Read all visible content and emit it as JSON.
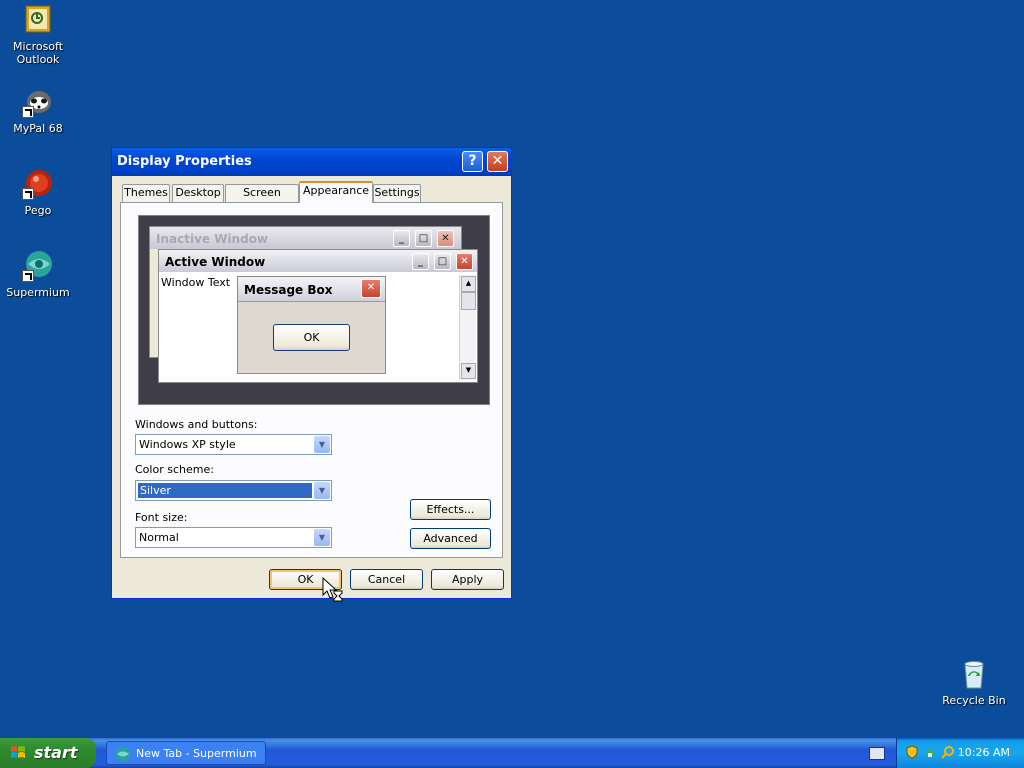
{
  "desktop": {
    "icons": [
      {
        "label_line1": "Microsoft",
        "label_line2": "Outlook"
      },
      {
        "label_line1": "MyPal 68",
        "label_line2": ""
      },
      {
        "label_line1": "Pego",
        "label_line2": ""
      },
      {
        "label_line1": "Supermium",
        "label_line2": ""
      },
      {
        "label_line1": "Recycle Bin",
        "label_line2": ""
      }
    ]
  },
  "dialog": {
    "title": "Display Properties",
    "help_glyph": "?",
    "close_glyph": "✕",
    "tabs": [
      {
        "label": "Themes",
        "active": false
      },
      {
        "label": "Desktop",
        "active": false
      },
      {
        "label": "Screen Saver",
        "active": false
      },
      {
        "label": "Appearance",
        "active": true
      },
      {
        "label": "Settings",
        "active": false
      }
    ],
    "preview": {
      "inactive_title": "Inactive Window",
      "active_title": "Active Window",
      "window_text": "Window Text",
      "message_box_title": "Message Box",
      "message_box_ok": "OK"
    },
    "form": {
      "windows_buttons_label": "Windows and buttons:",
      "windows_buttons_value": "Windows XP style",
      "color_scheme_label": "Color scheme:",
      "color_scheme_value": "Silver",
      "font_size_label": "Font size:",
      "font_size_value": "Normal"
    },
    "side_buttons": {
      "effects": "Effects...",
      "advanced": "Advanced"
    },
    "footer_buttons": {
      "ok": "OK",
      "cancel": "Cancel",
      "apply": "Apply"
    }
  },
  "taskbar": {
    "start_label": "start",
    "task_item_label": "New Tab - Supermium",
    "clock": "10:26 AM"
  },
  "colors": {
    "desktop_bg": "#0b4d9b",
    "titlebar_blue": "#0046d3",
    "dialog_face": "#ece9d8",
    "selection": "#316ac5"
  }
}
